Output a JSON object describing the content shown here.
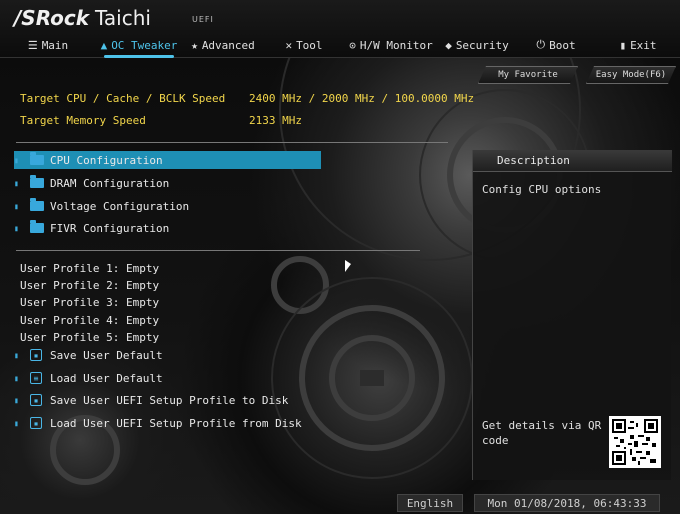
{
  "brand": {
    "name_bold": "/SRock",
    "name_thin": "Taichi",
    "uefi": "UEFI"
  },
  "tabs": [
    {
      "label": "Main",
      "icon": "☰"
    },
    {
      "label": "OC Tweaker",
      "icon": "▲"
    },
    {
      "label": "Advanced",
      "icon": "★"
    },
    {
      "label": "Tool",
      "icon": "✕"
    },
    {
      "label": "H/W Monitor",
      "icon": "⊙"
    },
    {
      "label": "Security",
      "icon": "◆"
    },
    {
      "label": "Boot",
      "icon": "⏻"
    },
    {
      "label": "Exit",
      "icon": "▮"
    }
  ],
  "favorites": {
    "my_favorite": "My Favorite",
    "easy_mode": "Easy Mode(F6)"
  },
  "info": {
    "cpu_label": "Target CPU / Cache / BCLK Speed",
    "cpu_value": "2400 MHz / 2000 MHz / 100.0000 MHz",
    "mem_label": "Target Memory Speed",
    "mem_value": "2133 MHz"
  },
  "menu": [
    {
      "label": "CPU Configuration",
      "selected": true
    },
    {
      "label": "DRAM Configuration",
      "selected": false
    },
    {
      "label": "Voltage Configuration",
      "selected": false
    },
    {
      "label": "FIVR Configuration",
      "selected": false
    }
  ],
  "profiles": [
    "User Profile 1: Empty",
    "User Profile 2: Empty",
    "User Profile 3: Empty",
    "User Profile 4: Empty",
    "User Profile 5: Empty"
  ],
  "actions": [
    "Save User Default",
    "Load User Default",
    "Save User UEFI Setup Profile to Disk",
    "Load User UEFI Setup Profile from Disk"
  ],
  "description": {
    "title": "Description",
    "text": "Config CPU options",
    "qr_text": "Get details via QR code"
  },
  "status": {
    "language": "English",
    "datetime": "Mon 01/08/2018, 06:43:33"
  },
  "colors": {
    "accent": "#4ec3ea",
    "highlight": "#1e8fb5",
    "value_yellow": "#f2d64b"
  }
}
